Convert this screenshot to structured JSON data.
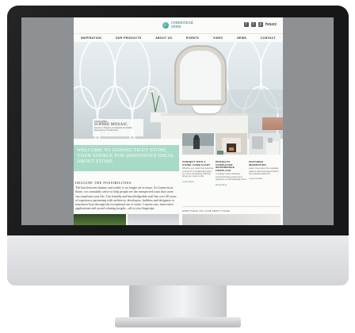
{
  "site": {
    "logo_name": "connecticut",
    "logo_name2": "stone",
    "social_icons": [
      "facebook-icon",
      "twitter-icon",
      "pinterest-icon",
      "houzz-icon"
    ],
    "houzz_label": "houzz",
    "nav": [
      "INSPIRATION",
      "OUR PRODUCTS",
      "ABOUT US",
      "EVENTS",
      "VIDEO",
      "NEWS",
      "CONTACT"
    ],
    "hero": {
      "caption_small": "FEATURED",
      "caption_title": "SOPHIE MOSAIC",
      "caption_sub": "Sophie in Thassos & Calacatta Tia Marble",
      "caption_sub2": "Designed by Tina Brunner",
      "prev_arrow": "‹",
      "next_arrow": "›"
    },
    "welcome": "WELCOME TO CONNECTICUT STONE, YOUR SOURCE FOR INNOVATIVE IDEAS ABOUT STONE.",
    "imagine_heading": "IMAGINE THE POSSIBILITIES",
    "paragraph": "The line between fantasy and reality is no longer set in stone. At Connecticut Stone, we constantly strive to help people see the unexpected ways that stone can transform your life. Our friendly and knowledgeable staff has over 40 years of experience partnering with architects, developers, builders and designers to transform lives through the exceptional use of stone. Custom cuts, innovative applications and award winning insight—all at your fingertips.",
    "columns": [
      {
        "title": "CONNECT WITH A STONE CONSULTANT",
        "body": "Whether you need help selecting a stone for a residential project, our stone consultants will help bring your vision to life.",
        "link": "Learn More"
      },
      {
        "title": "PROJECTS COMPLETED: WOODBRIDGE FIREPLACE",
        "body": "A striking custom fireplace surround brings warmth and elegance to a Woodbridge home.",
        "link": "Read More"
      },
      {
        "title": "FEATURED INSPIRATION",
        "body": "Learn more about the materials, patterns and techniques behind this beautiful bathroom.",
        "link": "Learn Details"
      }
    ],
    "footer_note": "EVERYTHING YOU LOVE ABOUT STONE"
  },
  "colors": {
    "accent_mint": "#a8dbc7",
    "brand_teal": "#3a7f78"
  }
}
